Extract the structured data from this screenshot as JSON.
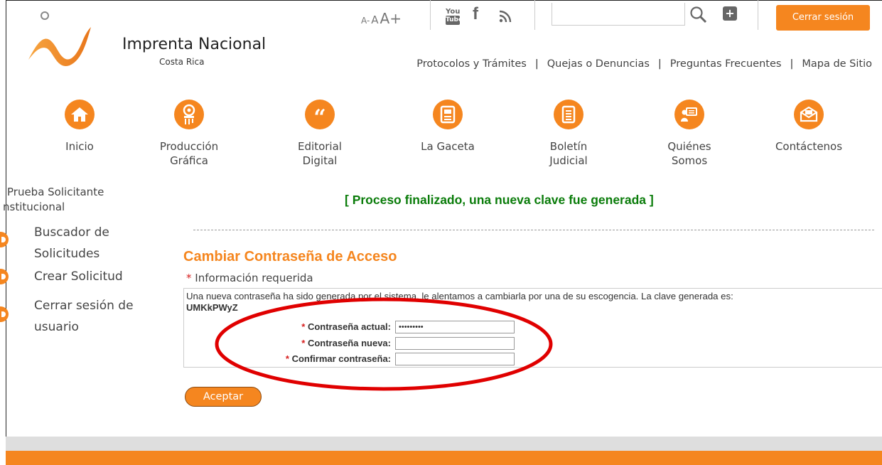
{
  "header": {
    "brand_name": "Imprenta Nacional",
    "brand_sub": "Costa Rica",
    "font_sizer": {
      "small": "A-",
      "medium": "A",
      "large": "A+"
    },
    "social_icons": [
      "youtube-icon",
      "facebook-icon",
      "rss-icon"
    ],
    "search_placeholder": "",
    "logout_label": "Cerrar sesión",
    "top_links": [
      "Protocolos y Trámites",
      "Quejas o Denuncias",
      "Preguntas Frecuentes",
      "Mapa de Sitio"
    ],
    "separator": "|"
  },
  "nav": [
    {
      "label": "Inicio",
      "icon": "home-icon"
    },
    {
      "label": "Producción\nGráfica",
      "icon": "print-icon"
    },
    {
      "label": "Editorial\nDigital",
      "icon": "quote-icon"
    },
    {
      "label": "La Gaceta",
      "icon": "newspaper-icon"
    },
    {
      "label": "Boletín\nJudicial",
      "icon": "document-icon"
    },
    {
      "label": "Quiénes\nSomos",
      "icon": "people-icon"
    },
    {
      "label": "Contáctenos",
      "icon": "mail-icon"
    }
  ],
  "sidebar": {
    "user_name": "Prueba Solicitante",
    "user_institution": "nstitucional",
    "items": [
      {
        "label": "Buscador de\nSolicitudes"
      },
      {
        "label": "Crear Solicitud"
      },
      {
        "label": "Cerrar sesión de\nusuario"
      }
    ]
  },
  "main": {
    "status_message": "[ Proceso finalizado, una nueva clave fue generada ]",
    "form_title": "Cambiar Contraseña de Acceso",
    "required_star": "*",
    "required_info": "Información requerida",
    "notice": "Una nueva contraseña ha sido generada por el sistema, le alentamos a cambiarla por una de su escogencia. La clave generada es:",
    "generated_password": "UMKkPWyZ",
    "fields": [
      {
        "label": "Contraseña actual:",
        "value": "•••••••••"
      },
      {
        "label": "Contraseña nueva:",
        "value": ""
      },
      {
        "label": "Confirmar contraseña:",
        "value": ""
      }
    ],
    "accept_label": "Aceptar"
  },
  "colors": {
    "accent": "#f5861f",
    "success": "#0a7c0a",
    "required": "#d62020",
    "annotation": "#e00000"
  }
}
